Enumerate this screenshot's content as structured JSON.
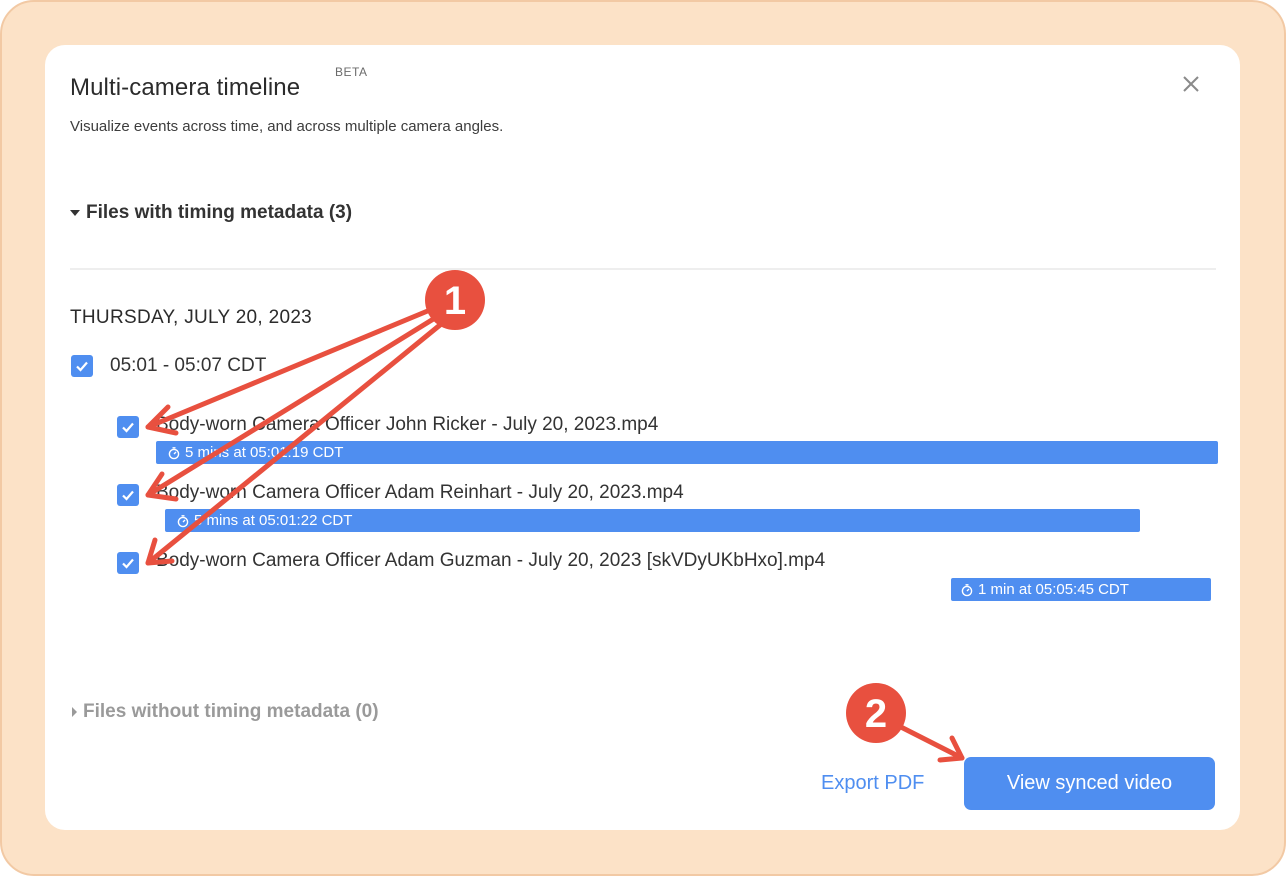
{
  "dialog": {
    "title": "Multi-camera timeline",
    "title_badge": "BETA",
    "subtitle": "Visualize events across time, and across multiple camera angles.",
    "close_icon": "close-icon"
  },
  "with_metadata": {
    "label": "Files with timing metadata (3)",
    "expanded": true,
    "date": "THURSDAY, JULY 20, 2023",
    "group": {
      "range_label": "05:01 - 05:07 CDT",
      "checked": true
    },
    "files": [
      {
        "name": "Body-worn Camera Officer John Ricker - July 20, 2023.mp4",
        "duration": "5 mins at 05:01:19 CDT",
        "checked": true
      },
      {
        "name": "Body-worn Camera Officer Adam Reinhart - July 20, 2023.mp4",
        "duration": "5 mins at 05:01:22 CDT",
        "checked": true
      },
      {
        "name": "Body-worn Camera Officer Adam Guzman - July 20, 2023 [skVDyUKbHxo].mp4",
        "duration": "1 min at 05:05:45 CDT",
        "checked": true
      }
    ]
  },
  "without_metadata": {
    "label": "Files without timing metadata (0)",
    "expanded": false
  },
  "actions": {
    "export_label": "Export PDF",
    "primary_label": "View synced video"
  },
  "annotations": {
    "step1": "1",
    "step2": "2",
    "color": "#e8503f"
  },
  "colors": {
    "accent": "#4f8ef0",
    "frame": "#fce2c7"
  }
}
